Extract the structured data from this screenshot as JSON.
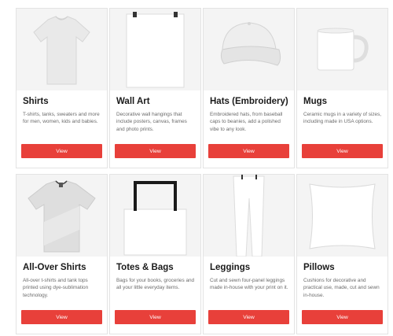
{
  "colors": {
    "button_bg": "#e8403a",
    "button_text": "#ffffff",
    "card_border": "#e3e3e3",
    "image_bg": "#f2f2f2"
  },
  "products": [
    {
      "title": "Shirts",
      "description": "T-shirts, tanks, sweaters and more for men, women, kids and babies.",
      "button_label": "View",
      "icon": "t-shirt-icon"
    },
    {
      "title": "Wall Art",
      "description": "Decorative wall hangings that include posters, canvas, frames and photo prints.",
      "button_label": "View",
      "icon": "poster-icon"
    },
    {
      "title": "Hats (Embroidery)",
      "description": "Embroidered hats, from baseball caps to beanies, add a polished vibe to any look.",
      "button_label": "View",
      "icon": "cap-icon"
    },
    {
      "title": "Mugs",
      "description": "Ceramic mugs in a variety of sizes, including made in USA options.",
      "button_label": "View",
      "icon": "mug-icon"
    },
    {
      "title": "All-Over Shirts",
      "description": "All-over t-shirts and tank tops printed using dye-sublimation technology.",
      "button_label": "View",
      "icon": "all-over-shirt-icon"
    },
    {
      "title": "Totes & Bags",
      "description": "Bags for your books, groceries and all your little everyday items.",
      "button_label": "View",
      "icon": "tote-bag-icon"
    },
    {
      "title": "Leggings",
      "description": "Cut and sewn four-panel leggings made in-house with your print on it.",
      "button_label": "View",
      "icon": "leggings-icon"
    },
    {
      "title": "Pillows",
      "description": "Cushions for decorative and practical use, made, cut and sewn in-house.",
      "button_label": "View",
      "icon": "pillow-icon"
    }
  ]
}
